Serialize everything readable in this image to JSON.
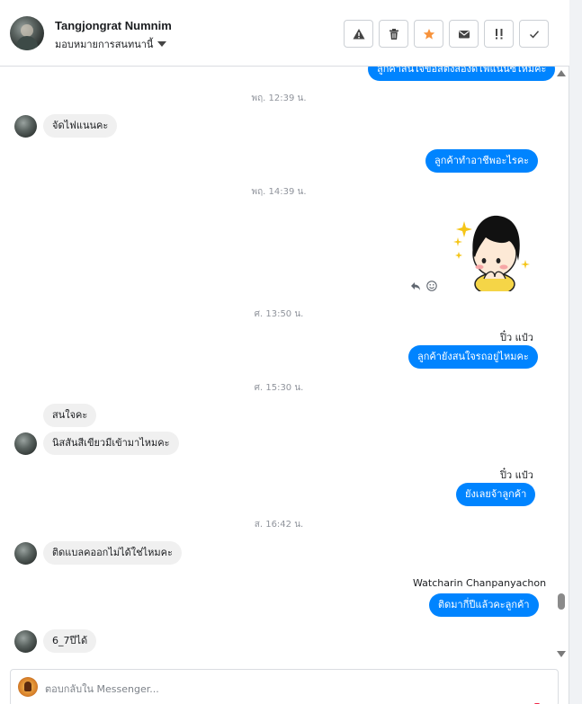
{
  "header": {
    "contact_name": "Tangjongrat Numnim",
    "assign_label": "มอบหมายการสนทนานี้",
    "tools": [
      "spam-icon",
      "trash-icon",
      "star-icon",
      "envelope-icon",
      "follow-up-icon",
      "check-icon"
    ]
  },
  "colors": {
    "accent": "#0084ff",
    "star": "#f7923b",
    "incoming_bg": "#f0f0f0"
  },
  "messages": {
    "top_partial": "ลูกค้าสนใจข้อสีตั้งสองดีไฟแนนซ์ไหมคะ",
    "t1": "พฤ. 12:39 น.",
    "m1": "จัดไฟแนนคะ",
    "m2": "ลูกค้าทำอาชีพอะไรคะ",
    "t2": "พฤ. 14:39 น.",
    "t3": "ศ. 13:50 น.",
    "sender1": "ปิ๋ว แป๋ว",
    "m3": "ลูกค้ายังสนใจรถอยู่ไหมคะ",
    "t4": "ศ. 15:30 น.",
    "m4": "สนใจคะ",
    "m5": "นิสสันสีเขียวมีเข้ามาไหมคะ",
    "sender2": "ปิ๋ว แป๋ว",
    "m6": "ยังเลยจ้าลูกค้า",
    "t5": "ส. 16:42 น.",
    "m7": "ติดแบลคออกไม่ได้ใช่ไหมคะ",
    "sender3": "Watcharin Chanpanyachon",
    "m8": "ติดมากี่ปีแล้วคะลูกค้า",
    "m9": "6_7ปีได้"
  },
  "composer": {
    "placeholder": "ตอบกลับใน Messenger..."
  }
}
